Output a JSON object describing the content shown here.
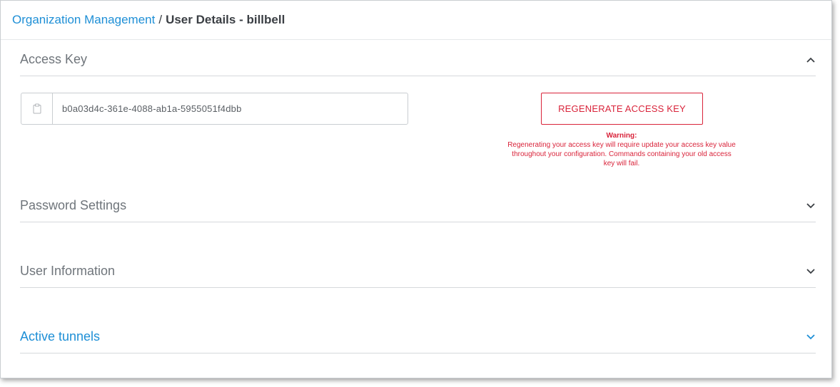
{
  "breadcrumb": {
    "parent": "Organization Management",
    "separator": "/",
    "current": "User Details - billbell"
  },
  "access_key": {
    "title": "Access Key",
    "value": "b0a03d4c-361e-4088-ab1a-5955051f4dbb",
    "copy_icon": "clipboard-icon",
    "regenerate_label": "REGENERATE ACCESS KEY",
    "warning_title": "Warning:",
    "warning_text": "Regenerating your access key will require update your access key value throughout your configuration. Commands containing your old access key will fail.",
    "expanded": true
  },
  "sections": [
    {
      "title": "Password Settings",
      "expanded": false
    },
    {
      "title": "User Information",
      "expanded": false
    },
    {
      "title": "Active tunnels",
      "expanded": false
    }
  ],
  "colors": {
    "link": "#1e8fd6",
    "danger": "#d9233a",
    "muted_text": "#6f757b"
  }
}
